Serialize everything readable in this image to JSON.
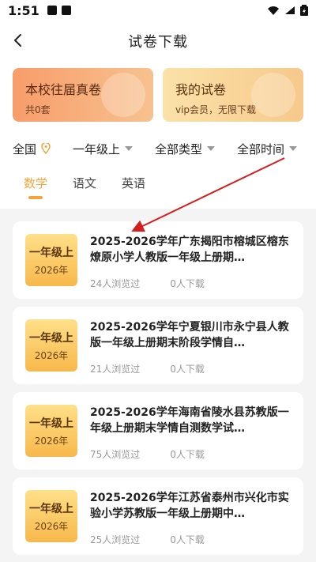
{
  "status": {
    "time": "1:51"
  },
  "header": {
    "title": "试卷下载"
  },
  "promos": [
    {
      "title": "本校往届真卷",
      "sub": "共0套"
    },
    {
      "title": "我的试卷",
      "sub": "vip会员，无限下载"
    }
  ],
  "filters": [
    "全国",
    "一年级上",
    "全部类型",
    "全部时间"
  ],
  "tabs": [
    "数学",
    "语文",
    "英语"
  ],
  "cards": [
    {
      "thumb_grade": "一年级上",
      "thumb_year": "2026年",
      "title": "2025-2026学年广东揭阳市榕城区榕东燎原小学人教版一年级上册期…",
      "views": "24人浏览过",
      "downloads": "0人下载"
    },
    {
      "thumb_grade": "一年级上",
      "thumb_year": "2026年",
      "title": "2025-2026学年宁夏银川市永宁县人教版一年级上册期末阶段学情自…",
      "views": "21人浏览过",
      "downloads": "0人下载"
    },
    {
      "thumb_grade": "一年级上",
      "thumb_year": "2026年",
      "title": "2025-2026学年海南省陵水县苏教版一年级上册期末学情自测数学试…",
      "views": "75人浏览过",
      "downloads": "0人下载"
    },
    {
      "thumb_grade": "一年级上",
      "thumb_year": "2026年",
      "title": "2025-2026学年江苏省泰州市兴化市实验小学苏教版一年级上册期中…",
      "views": "25人浏览过",
      "downloads": "0人下载"
    }
  ]
}
